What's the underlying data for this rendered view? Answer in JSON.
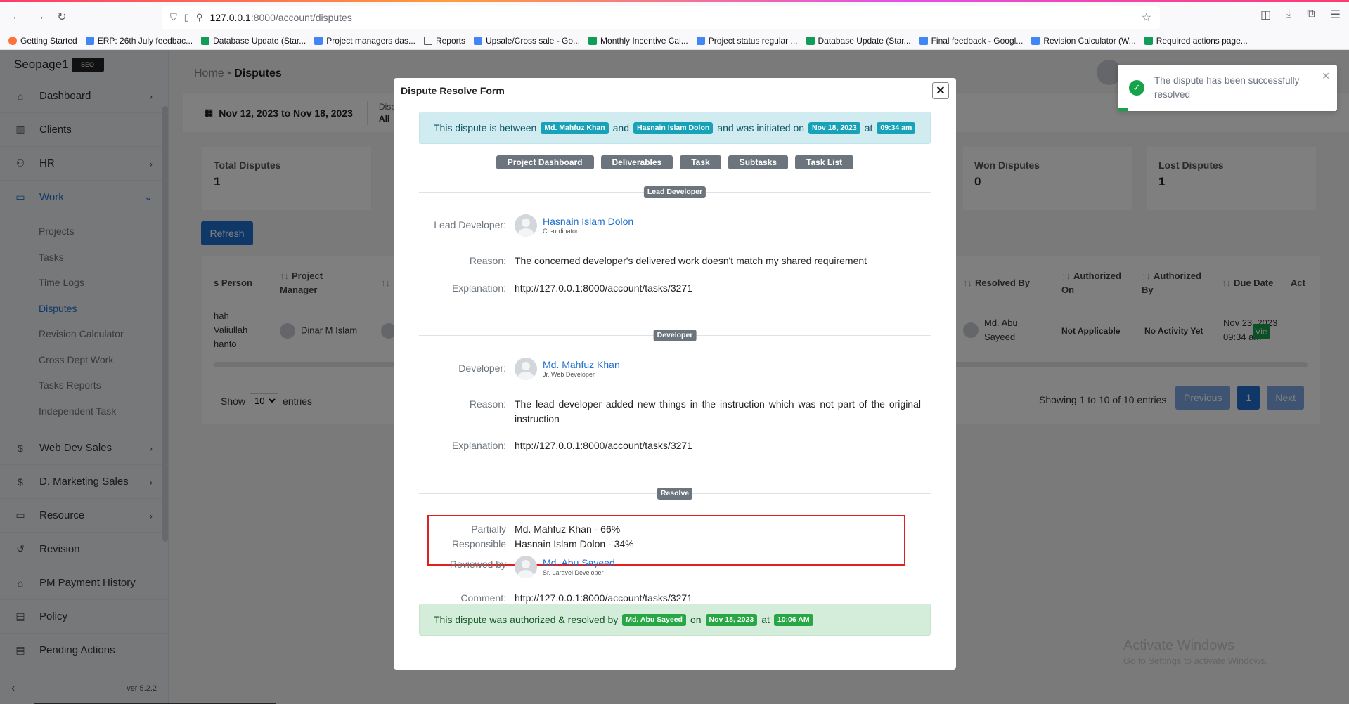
{
  "browser": {
    "url_host": "127.0.0.1",
    "url_rest": ":8000/account/disputes",
    "bookmarks": [
      {
        "label": "Getting Started",
        "icon": "fox"
      },
      {
        "label": "ERP: 26th July feedbac...",
        "icon": "blue"
      },
      {
        "label": "Database Update (Star...",
        "icon": "green"
      },
      {
        "label": "Project managers das...",
        "icon": "blue"
      },
      {
        "label": "Reports",
        "icon": "folder"
      },
      {
        "label": "Upsale/Cross sale - Go...",
        "icon": "blue"
      },
      {
        "label": "Monthly Incentive Cal...",
        "icon": "green"
      },
      {
        "label": "Project status regular ...",
        "icon": "blue"
      },
      {
        "label": "Database Update (Star...",
        "icon": "green"
      },
      {
        "label": "Final feedback - Googl...",
        "icon": "blue"
      },
      {
        "label": "Revision Calculator (W...",
        "icon": "blue"
      },
      {
        "label": "Required actions page...",
        "icon": "green"
      }
    ]
  },
  "sidebar": {
    "brand": "Seopage1",
    "brand_logo": "SEO",
    "items": [
      {
        "label": "Dashboard",
        "icon": "home-icon",
        "chev": "›"
      },
      {
        "label": "Clients",
        "icon": "chart-icon",
        "chev": ""
      },
      {
        "label": "HR",
        "icon": "users-icon",
        "chev": "›"
      },
      {
        "label": "Work",
        "icon": "briefcase-icon",
        "chev": "⌄"
      }
    ],
    "work_sub": [
      "Projects",
      "Tasks",
      "Time Logs",
      "Disputes",
      "Revision Calculator",
      "Cross Dept Work",
      "Tasks Reports",
      "Independent Task"
    ],
    "items_after": [
      {
        "label": "Web Dev Sales",
        "icon": "$",
        "chev": "›"
      },
      {
        "label": "D. Marketing Sales",
        "icon": "$",
        "chev": "›"
      },
      {
        "label": "Resource",
        "icon": "▭",
        "chev": "›"
      },
      {
        "label": "Revision",
        "icon": "↺",
        "chev": ""
      },
      {
        "label": "PM Payment History",
        "icon": "⌂",
        "chev": ""
      },
      {
        "label": "Policy",
        "icon": "▤",
        "chev": ""
      },
      {
        "label": "Pending Actions",
        "icon": "▤",
        "chev": ""
      }
    ],
    "version": "ver 5.2.2"
  },
  "page": {
    "breadcrumb_home": "Home",
    "breadcrumb_current": "Disputes",
    "date_range": "Nov 12, 2023 to Nov 18, 2023",
    "filter_label": "Dispute",
    "filter_value": "All",
    "stats": [
      {
        "label": "Total Disputes",
        "value": "1"
      },
      {
        "label": "Won Disputes",
        "value": "0"
      },
      {
        "label": "Lost Disputes",
        "value": "1"
      }
    ],
    "refresh": "Refresh",
    "table": {
      "headers": {
        "person": "s Person",
        "pm": "Project Manager",
        "resolved_by": "Resolved By",
        "auth_on": "Authorized On",
        "auth_by": "Authorized By",
        "due": "Due Date",
        "action": "Act"
      },
      "row": {
        "person": "hah\nValiullah\nhanto",
        "pm": "Dinar M Islam",
        "resolved_by": "Md. Abu\nSayeed",
        "auth_on": "Not Applicable",
        "auth_by": "No Activity Yet",
        "due": "Nov 23, 2023\n09:34 am",
        "action": "Vie"
      }
    },
    "show": "Show",
    "entries_value": "10",
    "entries": "entries",
    "showing": "Showing 1 to 10 of 10 entries",
    "pager": [
      "Previous",
      "1",
      "Next"
    ]
  },
  "modal": {
    "title": "Dispute Resolve Form",
    "intro": {
      "t1": "This dispute is between",
      "p1": "Md. Mahfuz Khan",
      "t2": "and",
      "p2": "Hasnain Islam Dolon",
      "t3": "and was initiated on",
      "date": "Nov 18, 2023",
      "t4": "at",
      "time": "09:34 am"
    },
    "buttons": [
      "Project Dashboard",
      "Deliverables",
      "Task",
      "Subtasks",
      "Task List"
    ],
    "lead": {
      "section": "Lead Developer",
      "label": "Lead Developer:",
      "name": "Hasnain Islam Dolon",
      "role": "Co-ordinator",
      "reason_label": "Reason:",
      "reason": "The concerned developer's delivered work doesn't match my shared requirement",
      "expl_label": "Explanation:",
      "expl": "http://127.0.0.1:8000/account/tasks/3271"
    },
    "dev": {
      "section": "Developer",
      "label": "Developer:",
      "name": "Md. Mahfuz Khan",
      "role": "Jr. Web Developer",
      "reason_label": "Reason:",
      "reason": "The lead developer added new things in the instruction which was not part of the original instruction",
      "expl_label": "Explanation:",
      "expl": "http://127.0.0.1:8000/account/tasks/3271"
    },
    "resolve": {
      "section": "Resolve",
      "partial_label_1": "Partially",
      "partial_label_2": "Responsible",
      "partial_1": "Md. Mahfuz Khan - 66%",
      "partial_2": "Hasnain Islam Dolon - 34%",
      "reviewed_label": "Reviewed by",
      "reviewer": "Md. Abu Sayeed",
      "reviewer_role": "Sr. Laravel Developer",
      "comment_label": "Comment:",
      "comment": "http://127.0.0.1:8000/account/tasks/3271"
    },
    "footer": {
      "t1": "This dispute was authorized & resolved by",
      "by": "Md. Abu Sayeed",
      "t2": "on",
      "date": "Nov 18, 2023",
      "t3": "at",
      "time": "10:06 AM"
    }
  },
  "toast": {
    "text": "The dispute has been successfully resolved"
  },
  "watermark": {
    "line1": "Activate Windows",
    "line2": "Go to Settings to activate Windows."
  }
}
